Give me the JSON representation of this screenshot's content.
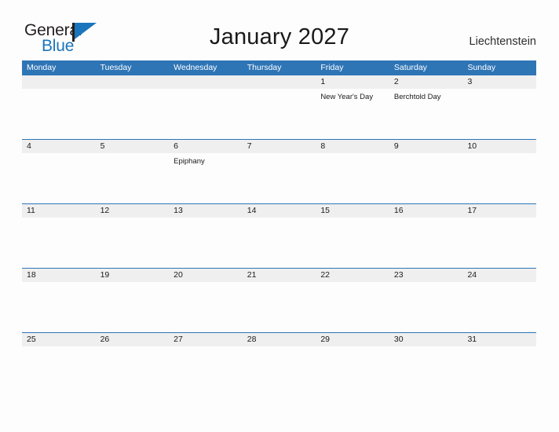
{
  "logo": {
    "word_top": "General",
    "word_bottom": "Blue",
    "flag_icon": "flag-triangle-icon",
    "accent_color": "#1b75bc",
    "dark_color": "#231f20"
  },
  "header": {
    "title": "January 2027",
    "region": "Liechtenstein"
  },
  "theme": {
    "header_blue": "#2e75b6",
    "band_gray": "#efefef",
    "page_background": "#fdfdfd",
    "text_color": "#1a1a1a"
  },
  "calendar": {
    "weekdays": [
      "Monday",
      "Tuesday",
      "Wednesday",
      "Thursday",
      "Friday",
      "Saturday",
      "Sunday"
    ],
    "weeks": [
      [
        {
          "date": "",
          "event": ""
        },
        {
          "date": "",
          "event": ""
        },
        {
          "date": "",
          "event": ""
        },
        {
          "date": "",
          "event": ""
        },
        {
          "date": "1",
          "event": "New Year's Day"
        },
        {
          "date": "2",
          "event": "Berchtold Day"
        },
        {
          "date": "3",
          "event": ""
        }
      ],
      [
        {
          "date": "4",
          "event": ""
        },
        {
          "date": "5",
          "event": ""
        },
        {
          "date": "6",
          "event": "Epiphany"
        },
        {
          "date": "7",
          "event": ""
        },
        {
          "date": "8",
          "event": ""
        },
        {
          "date": "9",
          "event": ""
        },
        {
          "date": "10",
          "event": ""
        }
      ],
      [
        {
          "date": "11",
          "event": ""
        },
        {
          "date": "12",
          "event": ""
        },
        {
          "date": "13",
          "event": ""
        },
        {
          "date": "14",
          "event": ""
        },
        {
          "date": "15",
          "event": ""
        },
        {
          "date": "16",
          "event": ""
        },
        {
          "date": "17",
          "event": ""
        }
      ],
      [
        {
          "date": "18",
          "event": ""
        },
        {
          "date": "19",
          "event": ""
        },
        {
          "date": "20",
          "event": ""
        },
        {
          "date": "21",
          "event": ""
        },
        {
          "date": "22",
          "event": ""
        },
        {
          "date": "23",
          "event": ""
        },
        {
          "date": "24",
          "event": ""
        }
      ],
      [
        {
          "date": "25",
          "event": ""
        },
        {
          "date": "26",
          "event": ""
        },
        {
          "date": "27",
          "event": ""
        },
        {
          "date": "28",
          "event": ""
        },
        {
          "date": "29",
          "event": ""
        },
        {
          "date": "30",
          "event": ""
        },
        {
          "date": "31",
          "event": ""
        }
      ]
    ]
  }
}
